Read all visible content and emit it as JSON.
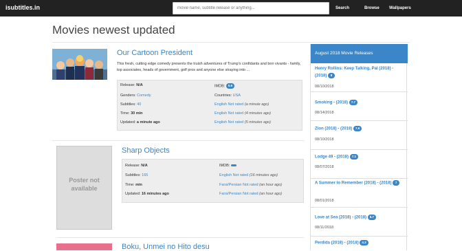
{
  "header": {
    "brand": "isubtitles.in",
    "search_placeholder": "movie name, subtitle release or anything...",
    "search_label": "Search",
    "browse_label": "Browse",
    "wallpapers_label": "Wallpapers"
  },
  "page_title": "Movies newest updated",
  "movies": [
    {
      "title": "Our Cartoon President",
      "description": "This fresh, cutting edge comedy presents the truish adventures of Trump's confidants and bon vivants - family, top associates, heads of government, golf pros and anyone else straying into ...",
      "release_label": "Release:",
      "release_value": "N/A",
      "imdb_label": "IMDB:",
      "imdb_value": "5.6",
      "genres_label": "Genders:",
      "genres_value": "Comedy",
      "countries_label": "Countries:",
      "countries_value": "USA",
      "subtitles_label": "Subtitles:",
      "subtitles_value": "40",
      "time_label": "Time:",
      "time_value": "30 min",
      "updated_label": "Updated:",
      "updated_value": "a minute ago",
      "subs": [
        {
          "lang": "English",
          "rating": "Not rated",
          "ago": "(a minute ago)"
        },
        {
          "lang": "English",
          "rating": "Not rated",
          "ago": "(4 minutes ago)"
        },
        {
          "lang": "English",
          "rating": "Not rated",
          "ago": "(5 minutes ago)"
        }
      ]
    },
    {
      "title": "Sharp Objects",
      "poster_text": "Poster not available",
      "release_label": "Release:",
      "release_value": "N/A",
      "imdb_label": "IMDB:",
      "subtitles_label": "Subtitles:",
      "subtitles_value": "165",
      "time_label": "Time:",
      "time_value": "min",
      "updated_label": "Updated:",
      "updated_value": "16 minutes ago",
      "subs": [
        {
          "lang": "English",
          "rating": "Not rated",
          "ago": "(16 minutes ago)"
        },
        {
          "lang": "Farsi/Persian",
          "rating": "Not rated",
          "ago": "(an hour ago)"
        },
        {
          "lang": "Farsi/Persian",
          "rating": "Not rated",
          "ago": "(an hour ago)"
        }
      ]
    },
    {
      "title": "Boku, Unmei no Hito desu"
    }
  ],
  "sidebar": {
    "heading": "August 2018 Movie Releases",
    "items": [
      {
        "title": "Henry Rollins: Keep Talking, Pal (2018) - (2018)",
        "rating": "8",
        "date": "08/10/2018"
      },
      {
        "title": "Smoking  - (2018)",
        "rating": "7.7",
        "date": "08/14/2018"
      },
      {
        "title": "Zion (2018) - (2018)",
        "rating": "7.6",
        "date": "08/10/2018"
      },
      {
        "title": "Lodge 49  - (2018)",
        "rating": "7.1",
        "date": "08/07/2018"
      },
      {
        "title": "A Summer to Remember (2018) - (2018)",
        "rating": "7",
        "date": "08/01/2018"
      },
      {
        "title": "Love at Sea (2018) - (2018)",
        "rating": "5.7",
        "date": "08/11/2018"
      },
      {
        "title": "Perdida (2018) - (2018)",
        "rating": "4.3",
        "date": ""
      }
    ]
  },
  "colors": {
    "topbar": "#222222",
    "accent": "#3a86c8",
    "info_box": "#eeeeee"
  }
}
